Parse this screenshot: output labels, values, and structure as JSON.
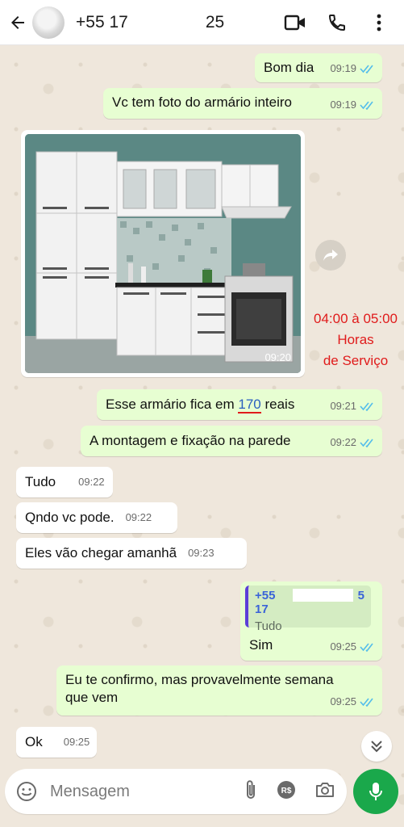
{
  "header": {
    "contact_prefix": "+55 17",
    "contact_suffix": "25"
  },
  "messages": [
    {
      "text": "Bom dia",
      "time": "09:19",
      "dir": "out"
    },
    {
      "text": "Vc tem foto do armário inteiro",
      "time": "09:19",
      "dir": "out"
    },
    {
      "text": "Esse armário fica em 170 reais",
      "time": "09:21",
      "dir": "out"
    },
    {
      "text": "A montagem e fixação na parede",
      "time": "09:22",
      "dir": "out"
    },
    {
      "text": "Tudo",
      "time": "09:22",
      "dir": "in"
    },
    {
      "text": "Qndo vc pode.",
      "time": "09:22",
      "dir": "in"
    },
    {
      "text": "Eles vão chegar amanhã",
      "time": "09:23",
      "dir": "in"
    },
    {
      "text": "Sim",
      "time": "09:25",
      "dir": "out"
    },
    {
      "text_line1": "Eu te confirmo, mas provavelmente semana",
      "text_line2": "que vem",
      "time": "09:25",
      "dir": "out"
    },
    {
      "text": "Ok",
      "time": "09:25",
      "dir": "in"
    }
  ],
  "price_parts": {
    "before": "Esse armário fica em ",
    "price": "170",
    "after": " reais"
  },
  "image_message": {
    "time": "09:20"
  },
  "annotation": {
    "line1": "04:00 à 05:00",
    "line2": "Horas",
    "line3": "de Serviço"
  },
  "quote": {
    "name_prefix": "+55 17",
    "name_suffix": "5",
    "text": "Tudo"
  },
  "input": {
    "placeholder": "Mensagem"
  },
  "colors": {
    "outgoing": "#e7fed2",
    "incoming": "#ffffff",
    "accent": "#1aa84b",
    "annotation": "#e01b1b",
    "read_tick": "#53bdeb"
  },
  "icons": [
    "back-arrow-icon",
    "video-call-icon",
    "phone-icon",
    "more-vert-icon",
    "forward-icon",
    "chevron-double-down-icon",
    "emoji-icon",
    "attach-icon",
    "payment-icon",
    "camera-icon",
    "mic-icon",
    "double-check-icon"
  ]
}
